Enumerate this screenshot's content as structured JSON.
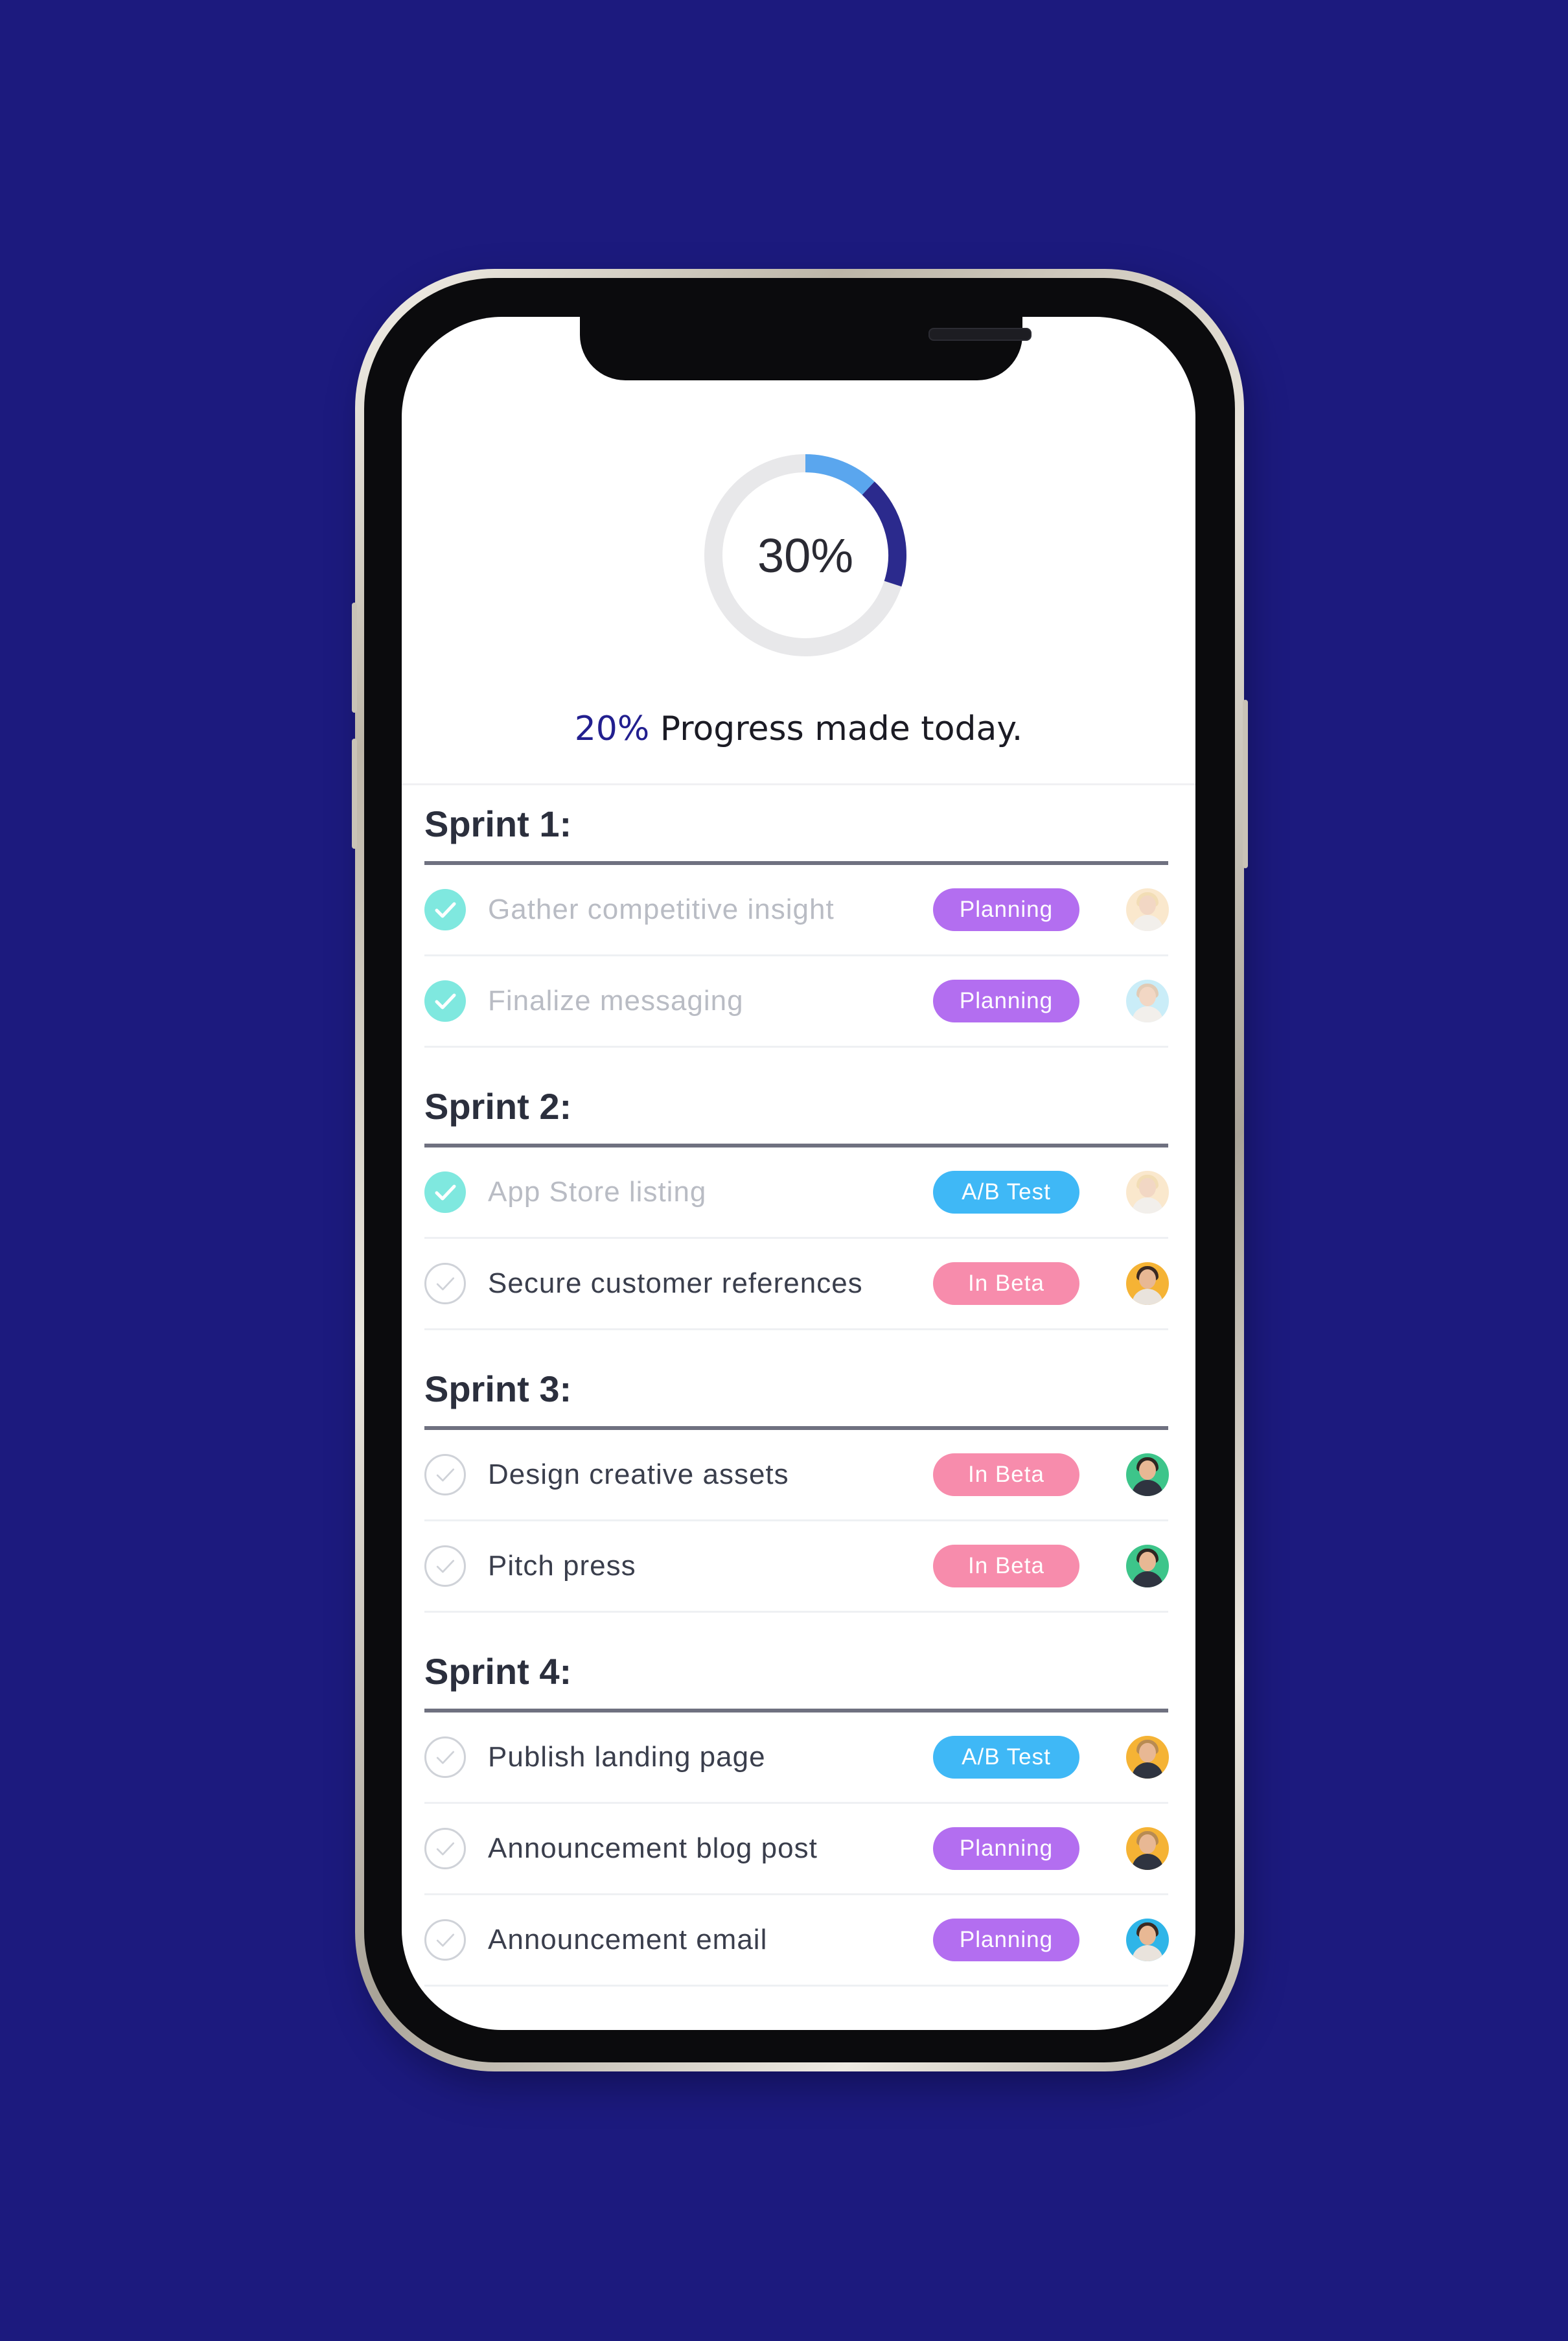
{
  "colors": {
    "background": "#1c1a7e",
    "accent_text": "#221f8f",
    "ring_track": "#e8e8ea",
    "ring_light": "#5aa6ee",
    "ring_dark": "#2b2a8d",
    "check_done": "#7fe8df"
  },
  "progress": {
    "ring_value": 30,
    "ring_label": "30%",
    "today_pct": "20%",
    "today_text": " Progress made today."
  },
  "sprints": [
    {
      "title": "Sprint 1:",
      "tasks": [
        {
          "label": "Gather competitive insight",
          "done": true,
          "tag": "Planning",
          "tag_color": "#b36ef0",
          "avatar_bg": "#f7d7a6",
          "avatar_icon": "avatar-woman-blonde"
        },
        {
          "label": "Finalize messaging",
          "done": true,
          "tag": "Planning",
          "tag_color": "#b36ef0",
          "avatar_bg": "#9fdff3",
          "avatar_icon": "avatar-woman-light"
        }
      ]
    },
    {
      "title": "Sprint 2:",
      "tasks": [
        {
          "label": "App Store listing",
          "done": true,
          "tag": "A/B Test",
          "tag_color": "#3fb8f6",
          "avatar_bg": "#f7d7a6",
          "avatar_icon": "avatar-woman-blonde"
        },
        {
          "label": "Secure customer references",
          "done": false,
          "tag": "In Beta",
          "tag_color": "#f78cac",
          "avatar_bg": "#f5b335",
          "avatar_icon": "avatar-woman-dark"
        }
      ]
    },
    {
      "title": "Sprint 3:",
      "tasks": [
        {
          "label": "Design creative assets",
          "done": false,
          "tag": "In Beta",
          "tag_color": "#f78cac",
          "avatar_bg": "#3dc58a",
          "avatar_icon": "avatar-man-dark"
        },
        {
          "label": "Pitch press",
          "done": false,
          "tag": "In Beta",
          "tag_color": "#f78cac",
          "avatar_bg": "#3dc58a",
          "avatar_icon": "avatar-man-dark"
        }
      ]
    },
    {
      "title": "Sprint 4:",
      "tasks": [
        {
          "label": "Publish landing page",
          "done": false,
          "tag": "A/B Test",
          "tag_color": "#3fb8f6",
          "avatar_bg": "#f5b335",
          "avatar_icon": "avatar-man-blonde"
        },
        {
          "label": "Announcement blog post",
          "done": false,
          "tag": "Planning",
          "tag_color": "#b36ef0",
          "avatar_bg": "#f5b335",
          "avatar_icon": "avatar-man-blonde"
        },
        {
          "label": "Announcement email",
          "done": false,
          "tag": "Planning",
          "tag_color": "#b36ef0",
          "avatar_bg": "#2fb5e8",
          "avatar_icon": "avatar-woman-dark"
        }
      ]
    }
  ]
}
